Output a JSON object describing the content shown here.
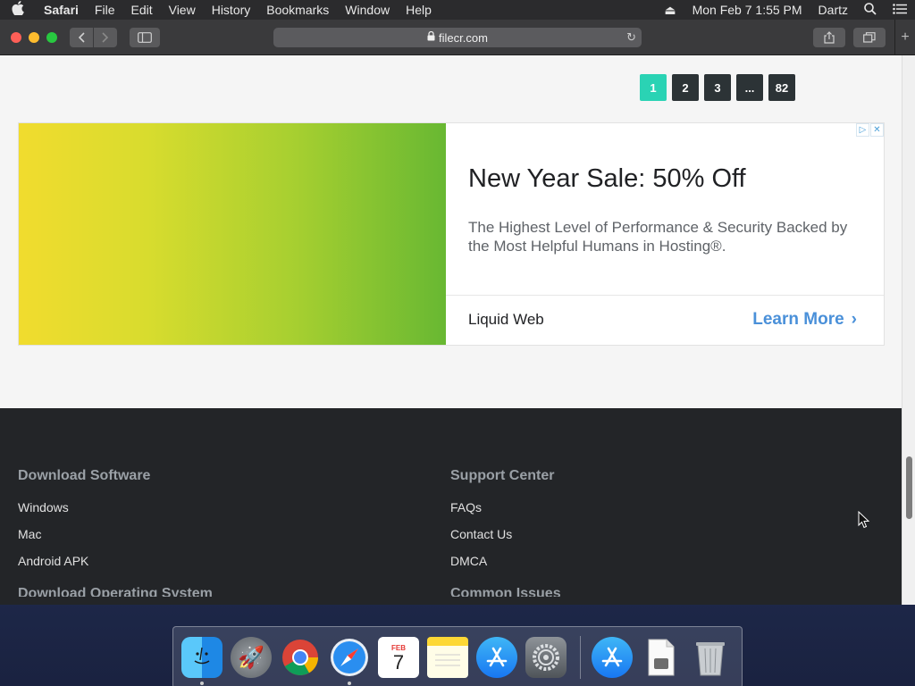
{
  "menubar": {
    "app_name": "Safari",
    "items": [
      "File",
      "Edit",
      "View",
      "History",
      "Bookmarks",
      "Window",
      "Help"
    ],
    "datetime": "Mon Feb 7  1:55 PM",
    "user": "Dartz"
  },
  "toolbar": {
    "url": "filecr.com"
  },
  "pagination": [
    "1",
    "2",
    "3",
    "...",
    "82"
  ],
  "ad": {
    "title": "New Year Sale: 50% Off",
    "description": "The Highest Level of Performance & Security Backed by the Most Helpful Humans in Hosting®.",
    "brand": "Liquid Web",
    "cta": "Learn More"
  },
  "footer": {
    "download_heading": "Download Software",
    "download_links": [
      "Windows",
      "Mac",
      "Android APK"
    ],
    "download_next_heading": "Download Operating System",
    "support_heading": "Support Center",
    "support_links": [
      "FAQs",
      "Contact Us",
      "DMCA"
    ],
    "support_next_heading": "Common Issues"
  },
  "dock": {
    "icons": [
      "finder-icon",
      "launchpad-icon",
      "chrome-icon",
      "safari-icon",
      "calendar-icon",
      "notes-icon",
      "app-store-icon",
      "system-preferences-icon",
      "app-store-downloads-icon",
      "document-icon",
      "trash-icon"
    ],
    "calendar_month": "FEB",
    "calendar_day": "7"
  }
}
